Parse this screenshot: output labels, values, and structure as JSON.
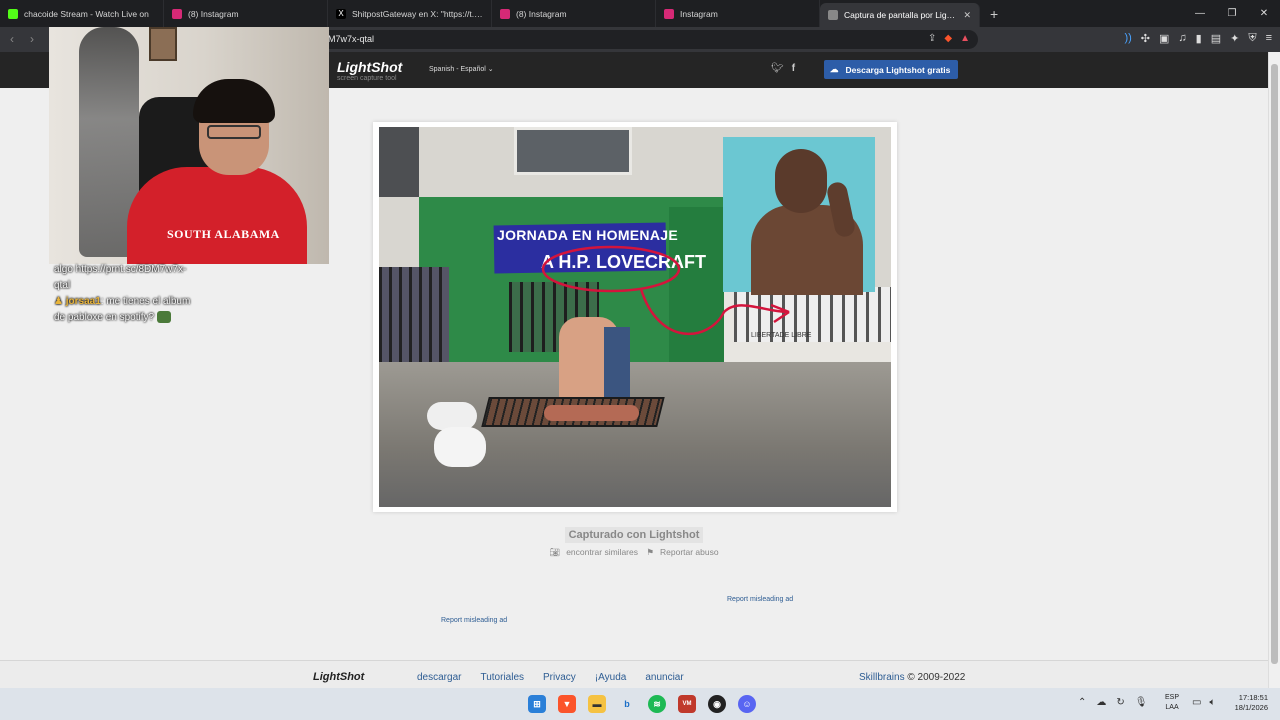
{
  "browser": {
    "tabs": [
      {
        "title": "chacoide Stream - Watch Live on",
        "favicon_color": "#53fc18"
      },
      {
        "title": "(8) Instagram",
        "favicon_color": "#d62976"
      },
      {
        "title": "ShitpostGateway en X: \"https://t.co/D",
        "favicon_color": "#000000"
      },
      {
        "title": "(8) Instagram",
        "favicon_color": "#d62976"
      },
      {
        "title": "Instagram",
        "favicon_color": "#d62976"
      },
      {
        "title": "Captura de pantalla por Lightshot",
        "favicon_color": "#888888",
        "active": true
      }
    ],
    "url": "M7w7x-qtal"
  },
  "lightshot": {
    "logo": "LightShot",
    "tagline": "screen capture tool",
    "language": "Spanish - Español",
    "download_button": "Descarga Lightshot gratis",
    "captured_label": "Capturado con Lightshot",
    "find_similar": "encontrar similares",
    "report_abuse": "Reportar abuso",
    "report_ad_1": "Report misleading ad",
    "report_ad_2": "Report misleading ad",
    "photo": {
      "banner_line1": "JORNADA EN HOMENAJE",
      "banner_line2": "A  H.P. LOVECRAFT",
      "wall_text": "LIBERTADE LIBRE"
    }
  },
  "chat": {
    "lines": [
      "algo https://prnt.sc/8DM7w7x-",
      "qtal"
    ],
    "msg_user": "jorsaa1",
    "msg_text_1": ": me tienes el album",
    "msg_text_2": "de pabloxe en spotify?"
  },
  "webcam": {
    "shirt_text": "SOUTH ALABAMA"
  },
  "footer": {
    "logo": "LightShot",
    "links": [
      "descargar",
      "Tutoriales",
      "Privacy",
      "¡Ayuda",
      "anunciar"
    ],
    "copyright_link": "Skillbrains",
    "copyright": "© 2009-2022"
  },
  "taskbar": {
    "lang_1": "ESP",
    "lang_2": "LAA",
    "time": "17:18:51",
    "date": "18/1/2026"
  },
  "colors": {
    "accent": "#2d5da8",
    "link": "#2e5d93",
    "header_bg": "#252525"
  }
}
